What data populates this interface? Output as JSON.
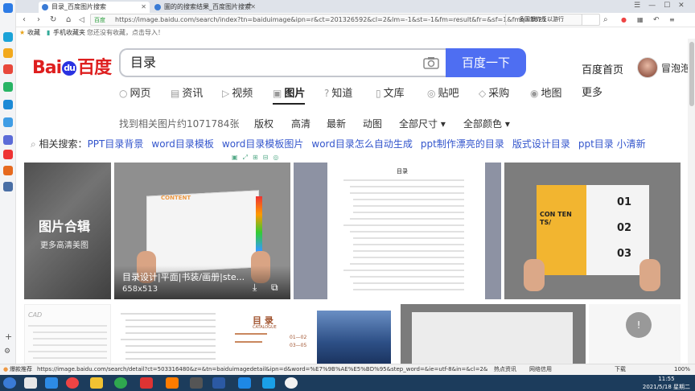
{
  "browser": {
    "tabs": [
      {
        "label": "目录_百度图片搜索"
      },
      {
        "label": "圖的的搜索结果_百度图片搜索"
      }
    ],
    "new_tab": "+",
    "url": "https://image.baidu.com/search/index?tn=baiduimage&ipn=r&ct=201326592&cl=2&lm=-1&st=-1&fm=result&fr=&sf=1&fmq=1621",
    "url_badge": "百度",
    "side_search": "多国爆炸反以游行",
    "bookmarks": {
      "star": "收藏",
      "mobile": "手机收藏夹",
      "hint": "您还没有收藏，点击导入！"
    },
    "window_controls": [
      "☰",
      "—",
      "☐",
      "✕"
    ]
  },
  "header": {
    "logo_bai": "Bai",
    "logo_du": "du",
    "logo_cn": "百度",
    "query": "目录",
    "search_button": "百度一下",
    "home_link": "百度首页",
    "username": "冒泡泡"
  },
  "nav": [
    {
      "icon": "○",
      "label": "网页"
    },
    {
      "icon": "▤",
      "label": "资讯"
    },
    {
      "icon": "▷",
      "label": "视频"
    },
    {
      "icon": "▣",
      "label": "图片",
      "active": true
    },
    {
      "icon": "?",
      "label": "知道"
    },
    {
      "icon": "▯",
      "label": "文库"
    },
    {
      "icon": "◎",
      "label": "贴吧"
    },
    {
      "icon": "◇",
      "label": "采购"
    },
    {
      "icon": "◉",
      "label": "地图"
    },
    {
      "icon": "",
      "label": "更多"
    }
  ],
  "filters": {
    "count": "找到相关图片约1071784张",
    "items": [
      "版权",
      "高清",
      "最新",
      "动图",
      "全部尺寸 ▾",
      "全部颜色 ▾"
    ]
  },
  "related": {
    "label": "相关搜索：",
    "items": [
      "PPT目录背景",
      "word目录模板",
      "word目录模板图片",
      "word目录怎么自动生成",
      "ppt制作漂亮的目录",
      "版式设计目录",
      "ppt目录 小清新"
    ]
  },
  "results": {
    "collection_title": "图片合辑",
    "collection_sub": "更多高清美图",
    "hover_caption": "目录设计|平面|书装/画册|ste...",
    "hover_size": "658x513",
    "doc_title": "目录",
    "book_headline": "CONTENT",
    "magazine_numbers": [
      "01",
      "02",
      "03"
    ],
    "magazine_cover": "CON TEN TS/",
    "thumb_catalog": "目 录",
    "thumb_catalog_sub": "CATALOGUE",
    "thumb_pages": [
      "01—02",
      "03—05"
    ]
  },
  "statusbar": {
    "left": "爆款推荐",
    "url": "https://image.baidu.com/search/detail?ct=503316480&z=&tn=baiduimagedetail&ipn=d&word=%E7%9B%AE%E5%BD%95&step_word=&ie=utf-8&in=&cl=2&lm=-1&st=-1",
    "hot": "热点资讯",
    "net": "网络信用",
    "download": "下载",
    "zoom": "100%"
  },
  "taskbar": {
    "time": "11:55",
    "date": "2021/5/18 星期二"
  },
  "colors": {
    "accent": "#4e6ef2",
    "link": "#3355cc",
    "logo_red": "#de1f1f",
    "logo_blue": "#2932e1"
  }
}
